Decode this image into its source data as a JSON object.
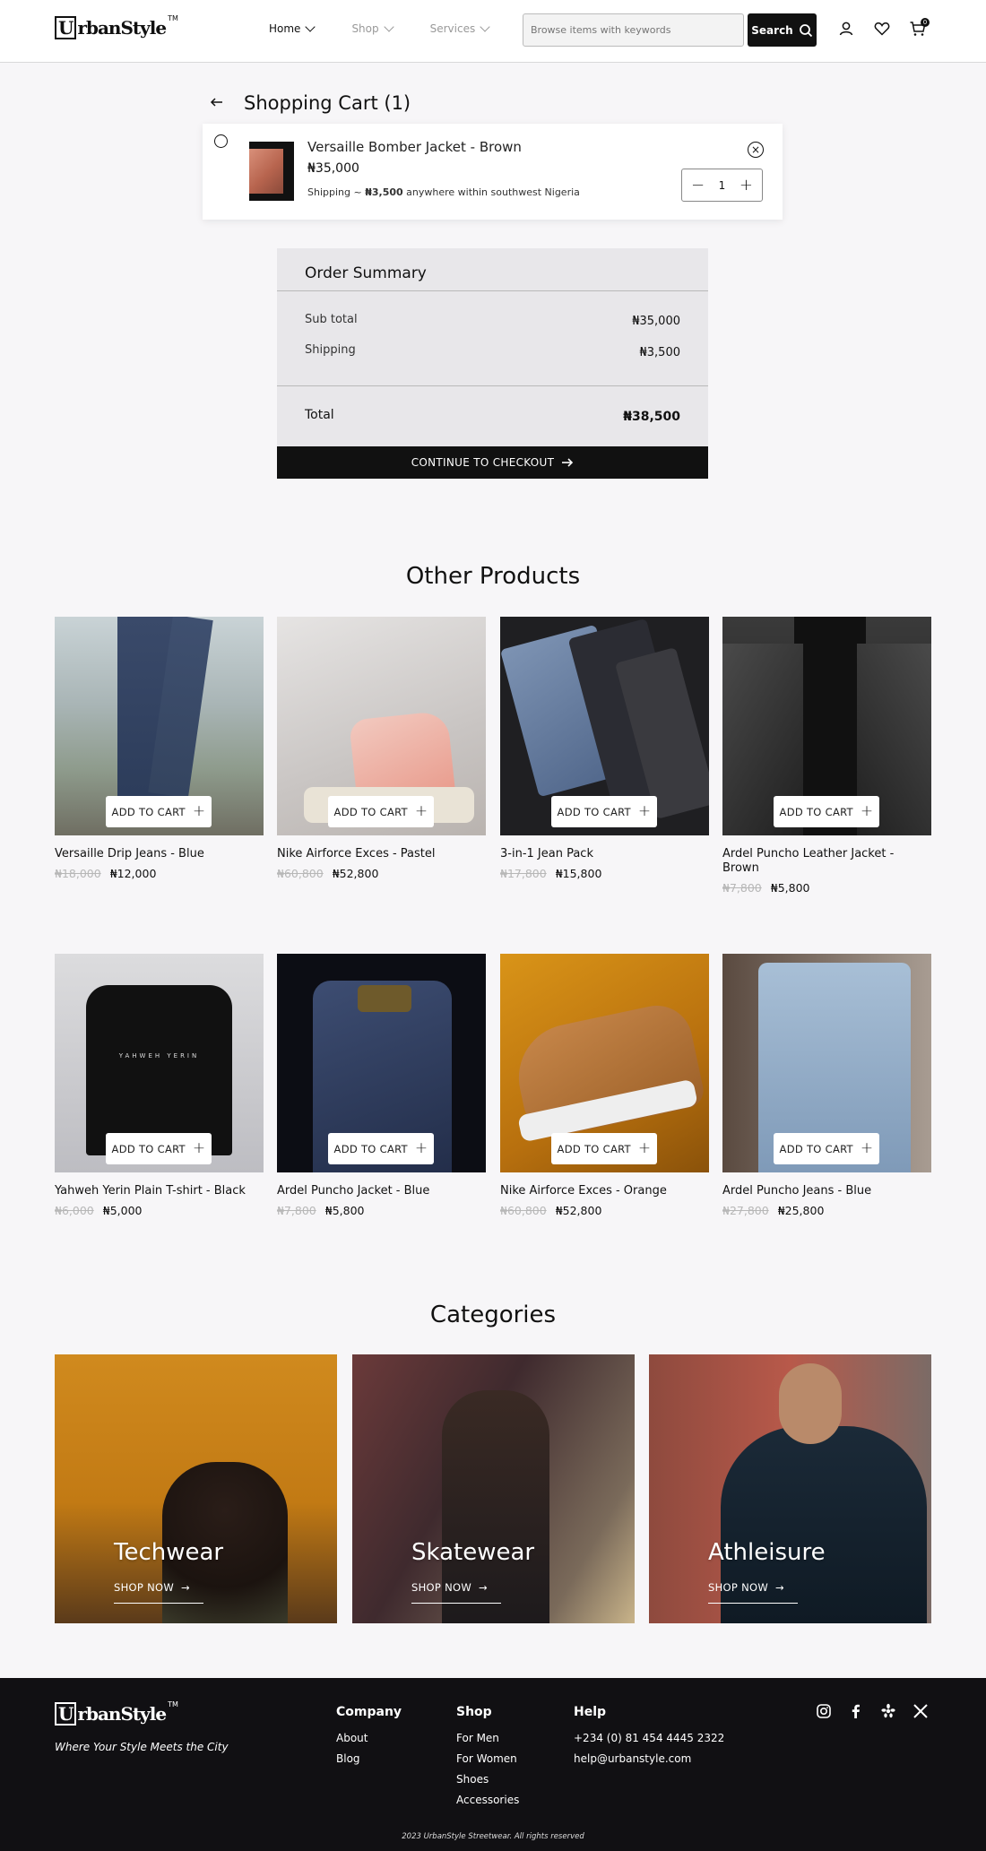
{
  "header": {
    "logo_text": "UrbanStyle",
    "logo_tm": "TM",
    "nav": [
      {
        "label": "Home"
      },
      {
        "label": "Shop"
      },
      {
        "label": "Services"
      }
    ],
    "search_placeholder": "Browse items with keywords",
    "search_label": "Search",
    "cart_count": "0",
    "icons": [
      "user-icon",
      "heart-icon",
      "cart-icon"
    ]
  },
  "cart": {
    "title": "Shopping Cart (1)",
    "item": {
      "name": "Versaille Bomber Jacket - Brown",
      "price": "₦35,000",
      "shipping_prefix": "Shipping ~ ",
      "shipping_amount": "₦3,500",
      "shipping_suffix": " anywhere within southwest Nigeria",
      "quantity": "1"
    }
  },
  "summary": {
    "title": "Order Summary",
    "subtotal_label": "Sub total",
    "subtotal_value": "₦35,000",
    "shipping_label": "Shipping",
    "shipping_value": "₦3,500",
    "total_label": "Total",
    "total_value": "₦38,500",
    "checkout_label": "CONTINUE TO CHECKOUT"
  },
  "other_products": {
    "title": "Other Products",
    "add_to_cart_label": "ADD TO CART",
    "items": [
      {
        "name": "Versaille Drip Jeans - Blue",
        "old_price": "₦18,000",
        "price": "₦12,000"
      },
      {
        "name": "Nike Airforce Exces - Pastel",
        "old_price": "₦60,800",
        "price": "₦52,800"
      },
      {
        "name": "3-in-1 Jean Pack",
        "old_price": "₦17,800",
        "price": "₦15,800"
      },
      {
        "name": "Ardel Puncho Leather Jacket - Brown",
        "old_price": "₦7,800",
        "price": "₦5,800"
      },
      {
        "name": "Yahweh Yerin Plain T-shirt - Black",
        "old_price": "₦6,000",
        "price": "₦5,000"
      },
      {
        "name": "Ardel Puncho Jacket - Blue",
        "old_price": "₦7,800",
        "price": "₦5,800"
      },
      {
        "name": "Nike Airforce Exces - Orange",
        "old_price": "₦60,800",
        "price": "₦52,800"
      },
      {
        "name": "Ardel Puncho Jeans - Blue",
        "old_price": "₦27,800",
        "price": "₦25,800"
      }
    ]
  },
  "categories": {
    "title": "Categories",
    "shop_label": "SHOP NOW",
    "items": [
      {
        "name": "Techwear"
      },
      {
        "name": "Skatewear"
      },
      {
        "name": "Athleisure"
      }
    ]
  },
  "footer": {
    "tagline": "Where Your Style Meets the City",
    "company": {
      "title": "Company",
      "links": [
        "About",
        "Blog"
      ]
    },
    "shop": {
      "title": "Shop",
      "links": [
        "For Men",
        "For Women",
        "Shoes",
        "Accessories"
      ]
    },
    "help": {
      "title": "Help",
      "links": [
        "+234 (0) 81 454 4445 2322",
        "help@urbanstyle.com"
      ]
    },
    "social": [
      "instagram-icon",
      "facebook-icon",
      "yelp-icon",
      "x-icon"
    ],
    "copyright": "2023 UrbanStyle Streetwear. All rights reserved"
  }
}
